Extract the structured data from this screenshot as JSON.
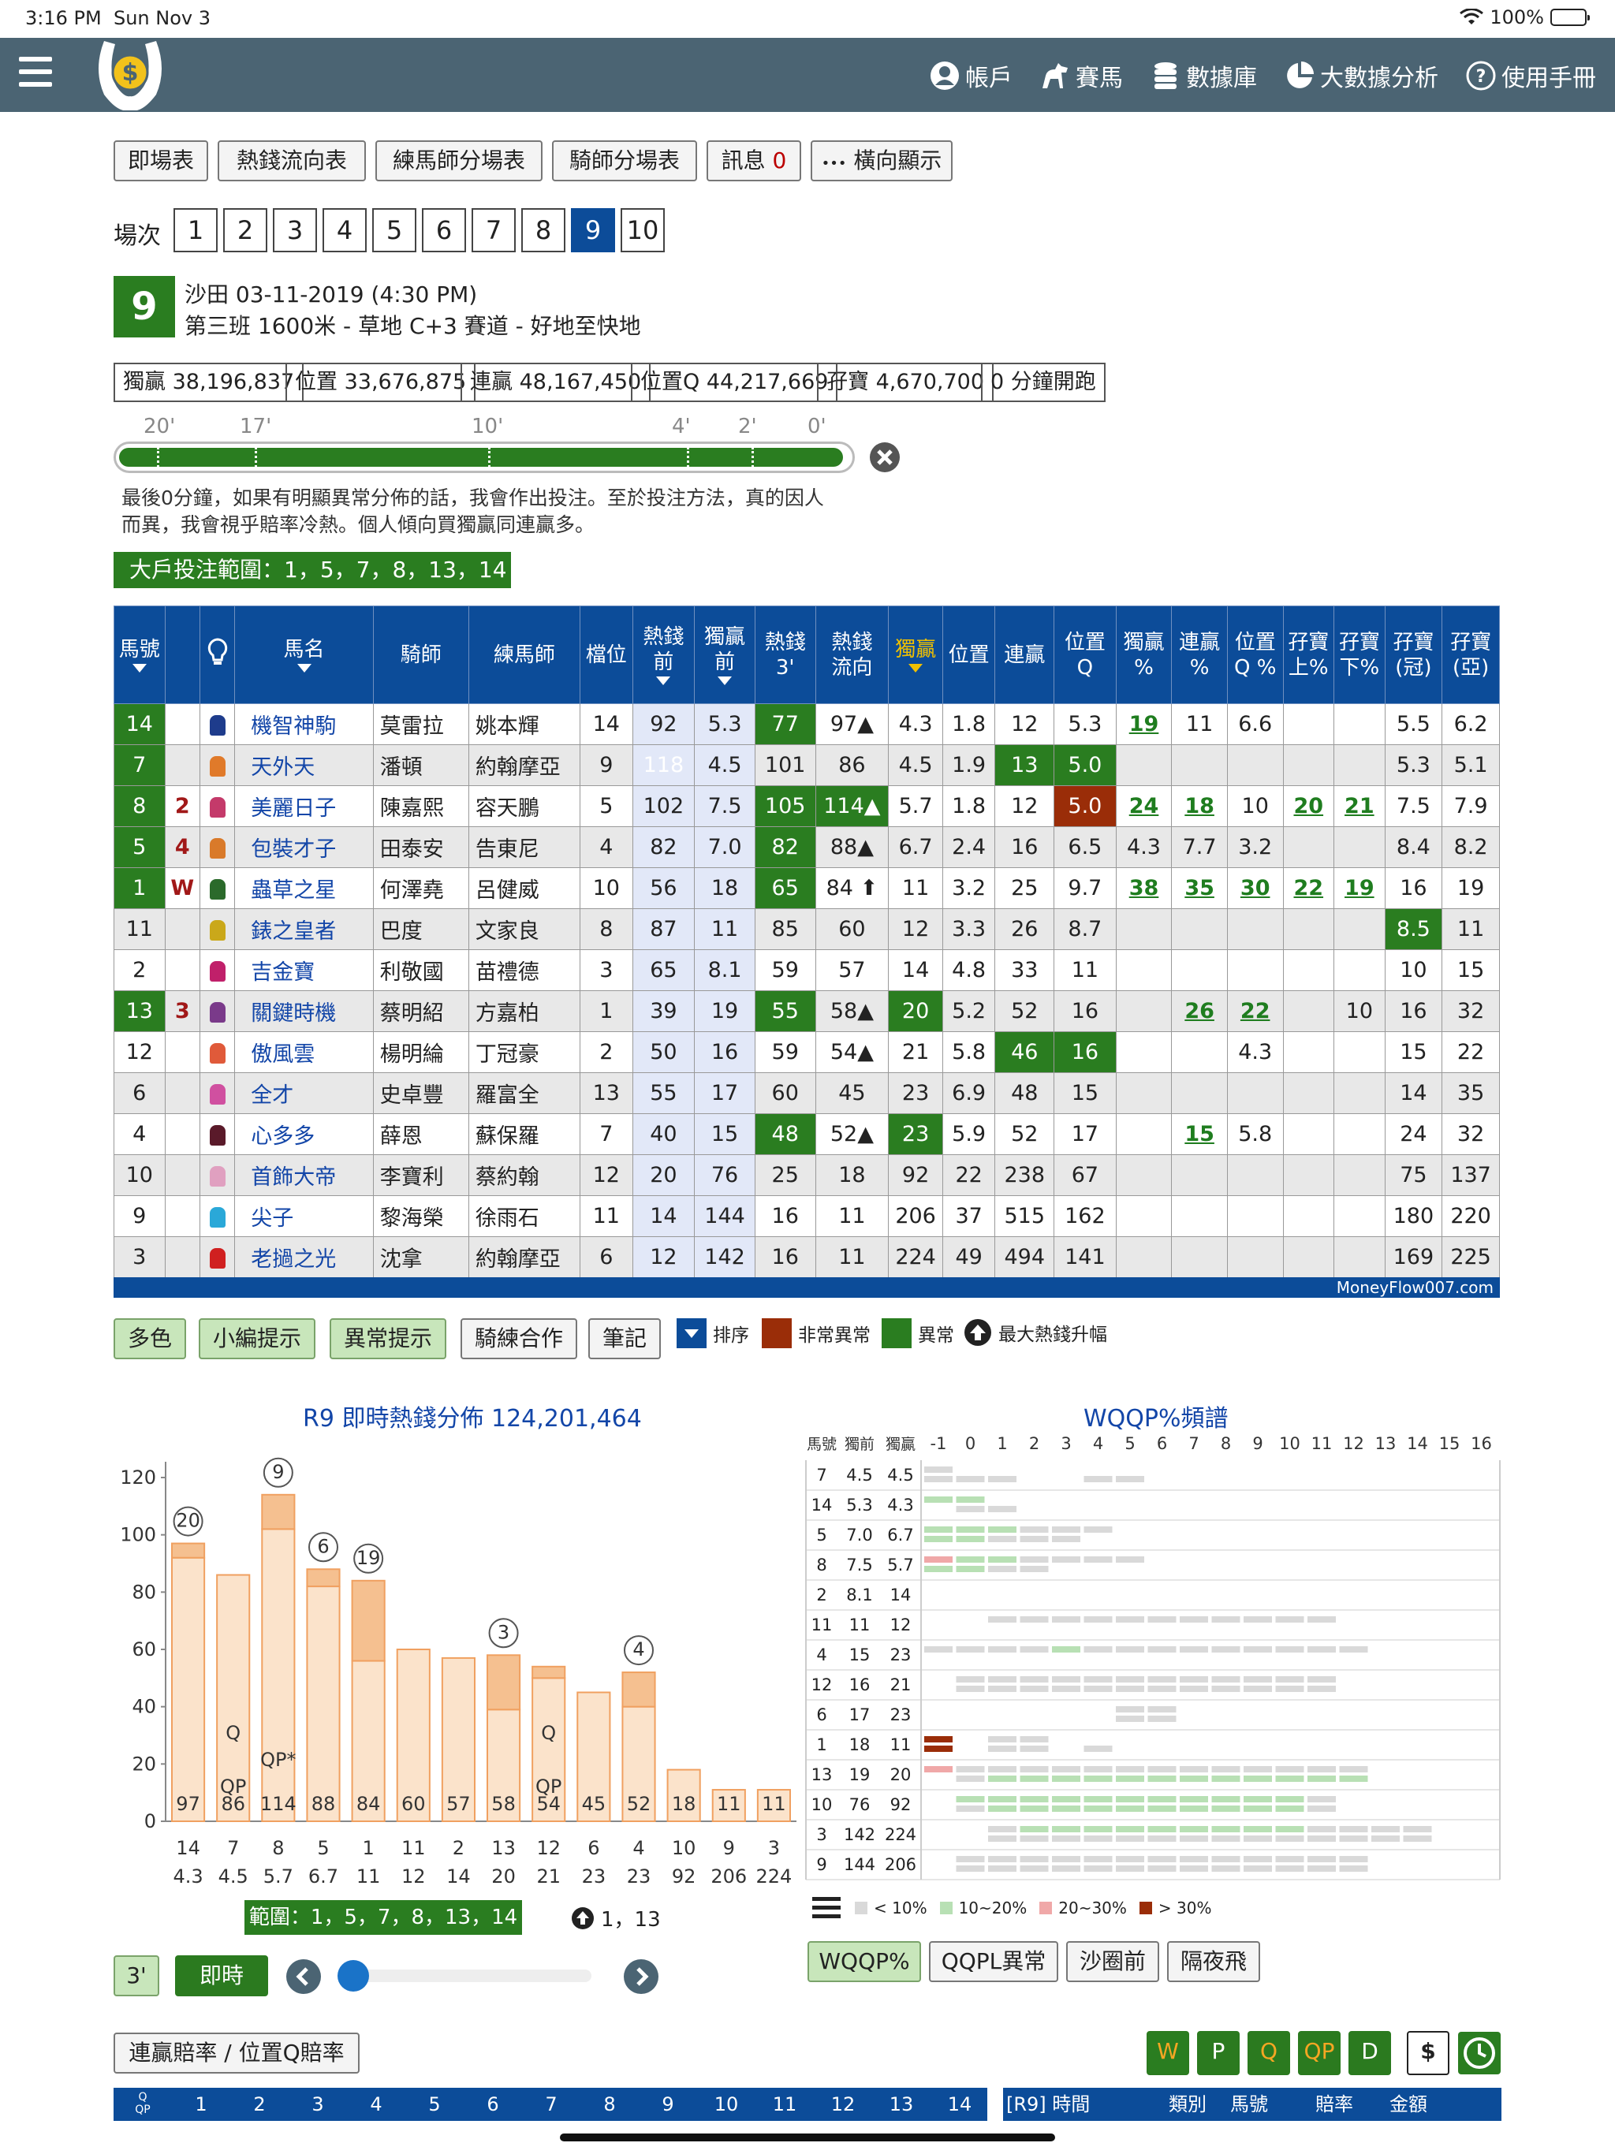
{
  "status": {
    "time": "3:16 PM",
    "date": "Sun Nov 3",
    "battery": "100%"
  },
  "nav": {
    "items": [
      {
        "label": "帳戶",
        "icon": "account-icon"
      },
      {
        "label": "賽馬",
        "icon": "horse-icon"
      },
      {
        "label": "數據庫",
        "icon": "database-icon"
      },
      {
        "label": "大數據分析",
        "icon": "pie-chart-icon"
      },
      {
        "label": "使用手冊",
        "icon": "help-icon"
      }
    ]
  },
  "toolbar": {
    "buttons": [
      "即場表",
      "熱錢流向表",
      "練馬師分場表",
      "騎師分場表",
      "訊息",
      "橫向顯示"
    ],
    "msg_count": "0",
    "dots": "•••"
  },
  "race_selector": {
    "label": "場次",
    "races": [
      "1",
      "2",
      "3",
      "4",
      "5",
      "6",
      "7",
      "8",
      "9",
      "10"
    ],
    "active": "9"
  },
  "race_info": {
    "number": "9",
    "line1": "沙田 03-11-2019 (4:30 PM)",
    "line2": "第三班 1600米 - 草地 C+3 賽道 - 好地至快地"
  },
  "pools": [
    "獨贏 38,196,837",
    "位置 33,676,875",
    "連贏 48,167,450",
    "位置Q 44,217,669",
    "孖寶 4,670,700",
    "0 分鐘開跑"
  ],
  "timeline": {
    "labels": [
      "20'",
      "17'",
      "10'",
      "4'",
      "2'",
      "0'"
    ]
  },
  "comment": {
    "line1": "最後0分鐘，如果有明顯異常分佈的話，我會作出投注。至於投注方法，真的因人",
    "line2": "而異，我會視乎賠率冷熱。個人傾向買獨贏同連贏多。"
  },
  "big_bet": "大戶投注範圍：1，5，7，8，13，14",
  "table": {
    "headers": [
      "馬號",
      "",
      "",
      "馬名",
      "騎師",
      "練馬師",
      "檔位",
      "熱錢\n前",
      "獨贏\n前",
      "熱錢\n3'",
      "熱錢\n流向",
      "獨贏",
      "位置",
      "連贏",
      "位置\nQ",
      "獨贏\n%",
      "連贏\n%",
      "位置\nQ %",
      "孖寶\n上%",
      "孖寶\n下%",
      "孖寶\n(冠)",
      "孖寶\n(亞)"
    ],
    "rows": [
      {
        "no": "14",
        "mark": "",
        "name": "機智神駒",
        "jockey": "莫雷拉",
        "trainer": "姚本輝",
        "draw": "14",
        "hm_pre": "92",
        "win_pre": "5.3",
        "hm3": "77",
        "flow": "97▲",
        "win": "4.3",
        "place": "1.8",
        "qin": "12",
        "qpl": "5.3",
        "winp": "19",
        "qinp": "11",
        "qplp": "6.6",
        "dbu": "",
        "dbd": "",
        "db1": "5.5",
        "db2": "6.2"
      },
      {
        "no": "7",
        "mark": "",
        "name": "天外天",
        "jockey": "潘頓",
        "trainer": "約翰摩亞",
        "draw": "9",
        "hm_pre": "118",
        "win_pre": "4.5",
        "hm3": "101",
        "flow": "86",
        "win": "4.5",
        "place": "1.9",
        "qin": "13",
        "qpl": "5.0",
        "winp": "",
        "qinp": "",
        "qplp": "",
        "dbu": "",
        "dbd": "",
        "db1": "5.3",
        "db2": "5.1"
      },
      {
        "no": "8",
        "mark": "2",
        "name": "美麗日子",
        "jockey": "陳嘉熙",
        "trainer": "容天鵬",
        "draw": "5",
        "hm_pre": "102",
        "win_pre": "7.5",
        "hm3": "105",
        "flow": "114▲",
        "win": "5.7",
        "place": "1.8",
        "qin": "12",
        "qpl": "5.0",
        "winp": "24",
        "qinp": "18",
        "qplp": "10",
        "dbu": "20",
        "dbd": "21",
        "db1": "7.5",
        "db2": "7.9"
      },
      {
        "no": "5",
        "mark": "4",
        "name": "包裝才子",
        "jockey": "田泰安",
        "trainer": "告東尼",
        "draw": "4",
        "hm_pre": "82",
        "win_pre": "7.0",
        "hm3": "82",
        "flow": "88▲",
        "win": "6.7",
        "place": "2.4",
        "qin": "16",
        "qpl": "6.5",
        "winp": "4.3",
        "qinp": "7.7",
        "qplp": "3.2",
        "dbu": "",
        "dbd": "",
        "db1": "8.4",
        "db2": "8.2"
      },
      {
        "no": "1",
        "mark": "W",
        "name": "蟲草之星",
        "jockey": "何澤堯",
        "trainer": "呂健威",
        "draw": "10",
        "hm_pre": "56",
        "win_pre": "18",
        "hm3": "65",
        "flow": "84 ⬆",
        "win": "11",
        "place": "3.2",
        "qin": "25",
        "qpl": "9.7",
        "winp": "38",
        "qinp": "35",
        "qplp": "30",
        "dbu": "22",
        "dbd": "19",
        "db1": "16",
        "db2": "19"
      },
      {
        "no": "11",
        "mark": "",
        "name": "錶之皇者",
        "jockey": "巴度",
        "trainer": "文家良",
        "draw": "8",
        "hm_pre": "87",
        "win_pre": "11",
        "hm3": "85",
        "flow": "60",
        "win": "12",
        "place": "3.3",
        "qin": "26",
        "qpl": "8.7",
        "winp": "",
        "qinp": "",
        "qplp": "",
        "dbu": "",
        "dbd": "",
        "db1": "8.5",
        "db2": "11"
      },
      {
        "no": "2",
        "mark": "",
        "name": "吉金寶",
        "jockey": "利敬國",
        "trainer": "苗禮德",
        "draw": "3",
        "hm_pre": "65",
        "win_pre": "8.1",
        "hm3": "59",
        "flow": "57",
        "win": "14",
        "place": "4.8",
        "qin": "33",
        "qpl": "11",
        "winp": "",
        "qinp": "",
        "qplp": "",
        "dbu": "",
        "dbd": "",
        "db1": "10",
        "db2": "15"
      },
      {
        "no": "13",
        "mark": "3",
        "name": "關鍵時機",
        "jockey": "蔡明紹",
        "trainer": "方嘉柏",
        "draw": "1",
        "hm_pre": "39",
        "win_pre": "19",
        "hm3": "55",
        "flow": "58▲",
        "win": "20",
        "place": "5.2",
        "qin": "52",
        "qpl": "16",
        "winp": "",
        "qinp": "26",
        "qplp": "22",
        "dbu": "",
        "dbd": "10",
        "db1": "16",
        "db2": "32"
      },
      {
        "no": "12",
        "mark": "",
        "name": "傲風雲",
        "jockey": "楊明綸",
        "trainer": "丁冠豪",
        "draw": "2",
        "hm_pre": "50",
        "win_pre": "16",
        "hm3": "59",
        "flow": "54▲",
        "win": "21",
        "place": "5.8",
        "qin": "46",
        "qpl": "16",
        "winp": "",
        "qinp": "",
        "qplp": "4.3",
        "dbu": "",
        "dbd": "",
        "db1": "15",
        "db2": "22"
      },
      {
        "no": "6",
        "mark": "",
        "name": "全才",
        "jockey": "史卓豐",
        "trainer": "羅富全",
        "draw": "13",
        "hm_pre": "55",
        "win_pre": "17",
        "hm3": "60",
        "flow": "45",
        "win": "23",
        "place": "6.9",
        "qin": "48",
        "qpl": "15",
        "winp": "",
        "qinp": "",
        "qplp": "",
        "dbu": "",
        "dbd": "",
        "db1": "14",
        "db2": "35"
      },
      {
        "no": "4",
        "mark": "",
        "name": "心多多",
        "jockey": "薛恩",
        "trainer": "蘇保羅",
        "draw": "7",
        "hm_pre": "40",
        "win_pre": "15",
        "hm3": "48",
        "flow": "52▲",
        "win": "23",
        "place": "5.9",
        "qin": "52",
        "qpl": "17",
        "winp": "",
        "qinp": "15",
        "qplp": "5.8",
        "dbu": "",
        "dbd": "",
        "db1": "24",
        "db2": "32"
      },
      {
        "no": "10",
        "mark": "",
        "name": "首飾大帝",
        "jockey": "李寶利",
        "trainer": "蔡約翰",
        "draw": "12",
        "hm_pre": "20",
        "win_pre": "76",
        "hm3": "25",
        "flow": "18",
        "win": "92",
        "place": "22",
        "qin": "238",
        "qpl": "67",
        "winp": "",
        "qinp": "",
        "qplp": "",
        "dbu": "",
        "dbd": "",
        "db1": "75",
        "db2": "137"
      },
      {
        "no": "9",
        "mark": "",
        "name": "尖子",
        "jockey": "黎海榮",
        "trainer": "徐雨石",
        "draw": "11",
        "hm_pre": "14",
        "win_pre": "144",
        "hm3": "16",
        "flow": "11",
        "win": "206",
        "place": "37",
        "qin": "515",
        "qpl": "162",
        "winp": "",
        "qinp": "",
        "qplp": "",
        "dbu": "",
        "dbd": "",
        "db1": "180",
        "db2": "220"
      },
      {
        "no": "3",
        "mark": "",
        "name": "老撾之光",
        "jockey": "沈拿",
        "trainer": "約翰摩亞",
        "draw": "6",
        "hm_pre": "12",
        "win_pre": "142",
        "hm3": "16",
        "flow": "11",
        "win": "224",
        "place": "49",
        "qin": "494",
        "qpl": "141",
        "winp": "",
        "qinp": "",
        "qplp": "",
        "dbu": "",
        "dbd": "",
        "db1": "169",
        "db2": "225"
      }
    ],
    "footer": "MoneyFlow007.com"
  },
  "table_tools": {
    "buttons": [
      "多色",
      "小編提示",
      "異常提示",
      "騎練合作",
      "筆記"
    ],
    "legend": [
      "排序",
      "非常異常",
      "異常",
      "最大熱錢升幅"
    ]
  },
  "colors": {
    "nav": "#4b6473",
    "blue": "#0c4c99",
    "green": "#2a7d20",
    "red": "#9a2d08",
    "orange": "#f5b57c"
  },
  "chart_data": {
    "type": "bar",
    "title": "R9 即時熱錢分佈 124,201,464",
    "ylim": [
      0,
      120
    ],
    "yticks": [
      0,
      20,
      40,
      60,
      80,
      100,
      120
    ],
    "categories": [
      "14",
      "7",
      "8",
      "5",
      "1",
      "11",
      "2",
      "13",
      "12",
      "6",
      "4",
      "10",
      "9",
      "3"
    ],
    "odds": [
      "4.3",
      "4.5",
      "5.7",
      "6.7",
      "11",
      "12",
      "14",
      "20",
      "21",
      "23",
      "23",
      "92",
      "206",
      "224"
    ],
    "values": [
      97,
      86,
      114,
      88,
      84,
      60,
      57,
      58,
      54,
      45,
      52,
      18,
      11,
      11
    ],
    "previous": [
      92,
      86,
      102,
      82,
      56,
      60,
      57,
      39,
      50,
      45,
      40,
      18,
      11,
      11
    ],
    "badges": {
      "14": "20",
      "8": "9",
      "5": "6",
      "1": "19",
      "13": "3",
      "4": "4"
    },
    "bar_tags": {
      "7": "Q\nQP",
      "8": "QP*",
      "12": "Q\nQP"
    },
    "range_label": "範圍：1，5，7，8，13，14",
    "up_label": "1，13"
  },
  "chart_controls": {
    "btn3": "3'",
    "realtime": "即時"
  },
  "wqqp": {
    "title": "WQQP%頻譜",
    "headers": [
      "馬號",
      "獨前",
      "獨贏"
    ],
    "scale": [
      "-1",
      "0",
      "1",
      "2",
      "3",
      "4",
      "5",
      "6",
      "7",
      "8",
      "9",
      "10",
      "11",
      "12",
      "13",
      "14",
      "15",
      "16"
    ],
    "rows": [
      [
        "7",
        "4.5",
        "4.5"
      ],
      [
        "14",
        "5.3",
        "4.3"
      ],
      [
        "5",
        "7.0",
        "6.7"
      ],
      [
        "8",
        "7.5",
        "5.7"
      ],
      [
        "2",
        "8.1",
        "14"
      ],
      [
        "11",
        "11",
        "12"
      ],
      [
        "4",
        "15",
        "23"
      ],
      [
        "12",
        "16",
        "21"
      ],
      [
        "6",
        "17",
        "23"
      ],
      [
        "1",
        "18",
        "11"
      ],
      [
        "13",
        "19",
        "20"
      ],
      [
        "10",
        "76",
        "92"
      ],
      [
        "3",
        "142",
        "224"
      ],
      [
        "9",
        "144",
        "206"
      ]
    ],
    "legend": [
      "< 10%",
      "10~20%",
      "20~30%",
      "> 30%"
    ],
    "buttons": [
      "WQQP%",
      "QQPL異常",
      "沙圈前",
      "隔夜飛"
    ]
  },
  "bottom": {
    "odds_btn": "連贏賠率 / 位置Q賠率",
    "pool_btns": [
      "W",
      "P",
      "Q",
      "QP",
      "D"
    ],
    "grid_header": [
      "1",
      "2",
      "3",
      "4",
      "5",
      "6",
      "7",
      "8",
      "9",
      "10",
      "11",
      "12",
      "13",
      "14"
    ],
    "grid_corner": "Q\nQP",
    "log_header": [
      "[R9] 時間",
      "類別",
      "馬號",
      "賠率",
      "金額"
    ]
  }
}
